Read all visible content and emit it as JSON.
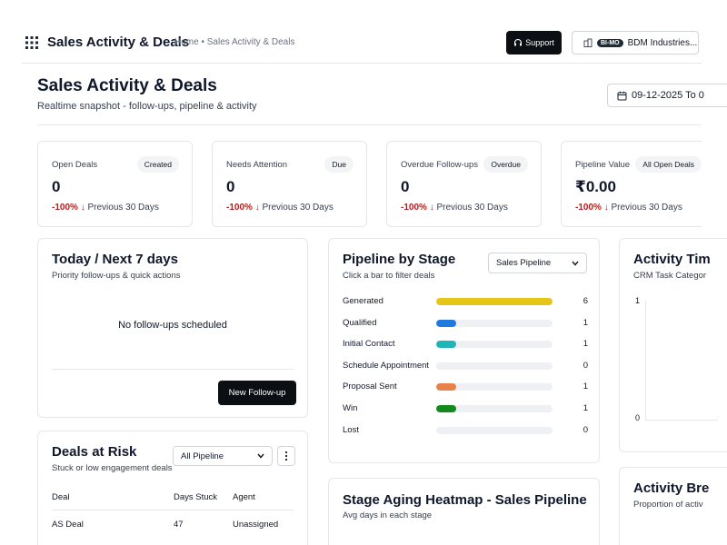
{
  "header": {
    "app_title": "Sales Activity & Deals",
    "breadcrumb": [
      "Home",
      "Sales Activity & Deals"
    ],
    "breadcrumb_sep": "•",
    "support_label": "Support",
    "company_badge": "BI-MO",
    "company_label": "BDM Industries..."
  },
  "page": {
    "title": "Sales Activity & Deals",
    "subtitle": "Realtime snapshot - follow-ups, pipeline & activity",
    "date_range": "09-12-2025 To 0"
  },
  "kpis": [
    {
      "label": "Open Deals",
      "badge": "Created",
      "value": "0",
      "change": "-100%",
      "compare": "Previous 30 Days"
    },
    {
      "label": "Needs Attention",
      "badge": "Due",
      "value": "0",
      "change": "-100%",
      "compare": "Previous 30 Days"
    },
    {
      "label": "Overdue Follow-ups",
      "badge": "Overdue",
      "value": "0",
      "change": "-100%",
      "compare": "Previous 30 Days"
    },
    {
      "label": "Pipeline Value",
      "badge": "All Open Deals",
      "value": "₹0.00",
      "change": "-100%",
      "compare": "Previous 30 Days"
    }
  ],
  "today": {
    "title": "Today / Next 7 days",
    "subtitle": "Priority follow-ups & quick actions",
    "empty": "No follow-ups scheduled",
    "button": "New Follow-up"
  },
  "risk": {
    "title": "Deals at Risk",
    "subtitle": "Stuck or low engagement deals",
    "filter": "All Pipeline",
    "columns": [
      "Deal",
      "Days Stuck",
      "Agent"
    ],
    "rows": [
      {
        "deal": "AS Deal",
        "days": "47",
        "agent": "Unassigned"
      }
    ]
  },
  "pipeline": {
    "title": "Pipeline by Stage",
    "subtitle": "Click a bar to filter deals",
    "select": "Sales Pipeline",
    "max": 6,
    "stages": [
      {
        "name": "Generated",
        "count": 6,
        "count_label": "6",
        "color": "#e5c617"
      },
      {
        "name": "Qualified",
        "count": 1,
        "count_label": "1",
        "color": "#1f7ae0"
      },
      {
        "name": "Initial Contact",
        "count": 1,
        "count_label": "1",
        "color": "#1fb5b8"
      },
      {
        "name": "Schedule Appointment",
        "count": 0,
        "count_label": "0",
        "color": "#9ca3af"
      },
      {
        "name": "Proposal Sent",
        "count": 1,
        "count_label": "1",
        "color": "#e9814a"
      },
      {
        "name": "Win",
        "count": 1,
        "count_label": "1",
        "color": "#138a1c"
      },
      {
        "name": "Lost",
        "count": 0,
        "count_label": "0",
        "color": "#9ca3af"
      }
    ]
  },
  "timeline": {
    "title": "Activity Tim",
    "subtitle": "CRM Task Categor",
    "y_top": "1",
    "y_bottom": "0"
  },
  "heatmap": {
    "title": "Stage Aging Heatmap - Sales Pipeline",
    "subtitle": "Avg days in each stage"
  },
  "breakdown": {
    "title": "Activity Bre",
    "subtitle": "Proportion of activ"
  }
}
